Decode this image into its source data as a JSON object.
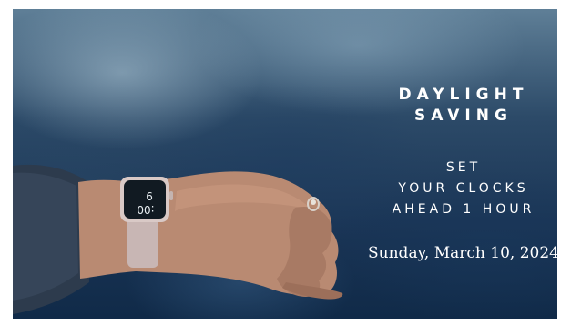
{
  "headline": {
    "line1": "DAYLIGHT",
    "line2": "SAVING"
  },
  "message": {
    "line1": "SET",
    "line2": "YOUR CLOCKS",
    "line3": "AHEAD 1 HOUR"
  },
  "date": "Sunday, March 10, 2024",
  "watch": {
    "hour_digit": "9",
    "minutes": ":00"
  },
  "colors": {
    "background": "#1a3556",
    "text": "#ffffff",
    "watch_band": "#c8b6b4"
  },
  "icons": [
    "smartwatch-icon",
    "ring-icon"
  ]
}
